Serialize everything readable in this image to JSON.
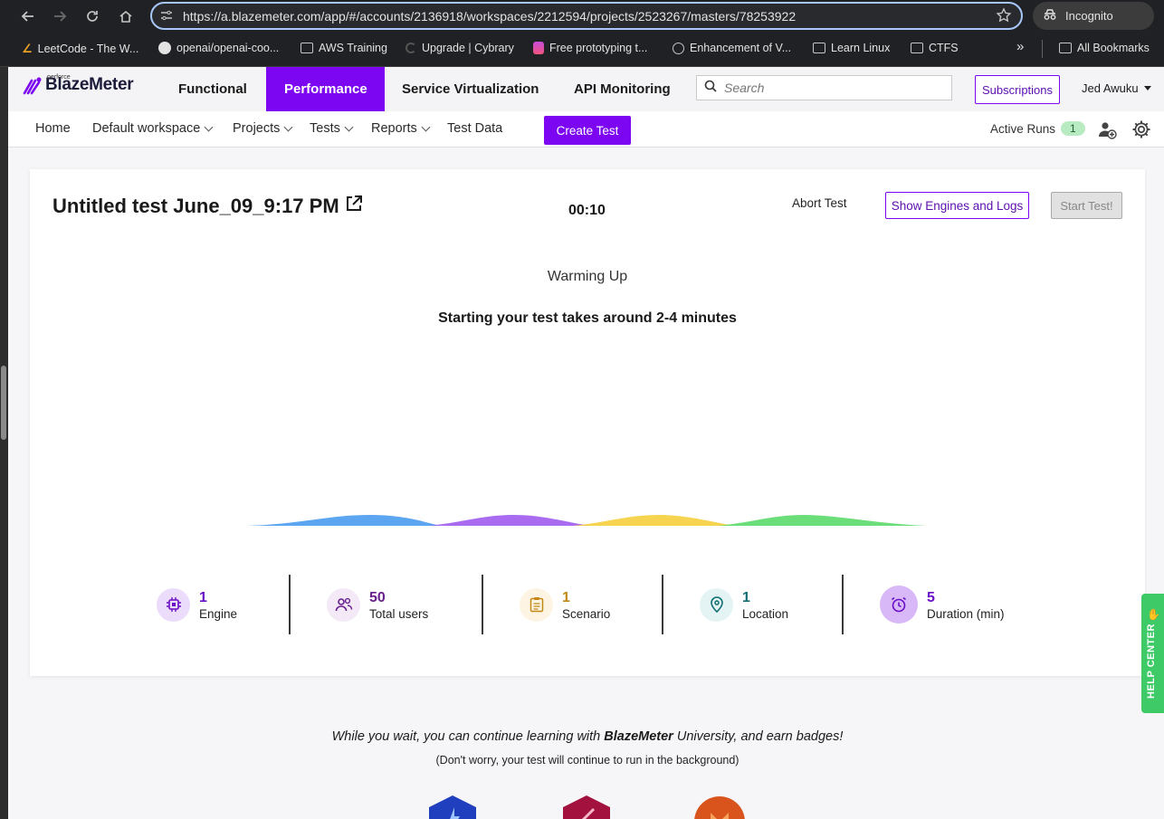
{
  "browser": {
    "url": "https://a.blazemeter.com/app/#/accounts/2136918/workspaces/2212594/projects/2523267/masters/78253922",
    "incognito_label": "Incognito",
    "bookmarks": [
      {
        "label": "LeetCode - The W...",
        "icon": "leetcode-icon"
      },
      {
        "label": "openai/openai-coo...",
        "icon": "github-icon"
      },
      {
        "label": "AWS Training",
        "icon": "folder-icon"
      },
      {
        "label": "Upgrade | Cybrary",
        "icon": "cybrary-icon"
      },
      {
        "label": "Free prototyping t...",
        "icon": "figma-icon"
      },
      {
        "label": "Enhancement of V...",
        "icon": "globe-icon"
      },
      {
        "label": "Learn Linux",
        "icon": "folder-icon"
      },
      {
        "label": "CTFS",
        "icon": "folder-icon"
      }
    ],
    "more_label": "»",
    "all_bookmarks_label": "All Bookmarks"
  },
  "header": {
    "logo_small": "perforce",
    "logo_text": "BlazeMeter",
    "tabs": [
      {
        "label": "Functional",
        "active": false
      },
      {
        "label": "Performance",
        "active": true
      },
      {
        "label": "Service Virtualization",
        "active": false
      },
      {
        "label": "API Monitoring",
        "active": false
      }
    ],
    "search_placeholder": "Search",
    "subscriptions_label": "Subscriptions",
    "user_name": "Jed Awuku"
  },
  "subnav": {
    "home": "Home",
    "workspace": "Default workspace",
    "projects": "Projects",
    "tests": "Tests",
    "reports": "Reports",
    "test_data": "Test Data",
    "create_test": "Create Test",
    "active_runs_label": "Active Runs",
    "active_runs_count": "1"
  },
  "test": {
    "title": "Untitled test June_09_9:17 PM",
    "timer": "00:10",
    "abort_label": "Abort Test",
    "show_engines_label": "Show Engines and Logs",
    "start_label": "Start Test!",
    "status": "Warming Up",
    "status_detail": "Starting your test takes around 2-4 minutes",
    "stats": [
      {
        "value": "1",
        "label": "Engine",
        "icon": "cpu-icon",
        "color": "#6a0dc6",
        "bg": "#ecdcfb"
      },
      {
        "value": "50",
        "label": "Total users",
        "icon": "users-icon",
        "color": "#6a1f8f",
        "bg": "#f3e9f7"
      },
      {
        "value": "1",
        "label": "Scenario",
        "icon": "clipboard-icon",
        "color": "#c28a14",
        "bg": "#fdf4e3"
      },
      {
        "value": "1",
        "label": "Location",
        "icon": "map-pin-icon",
        "color": "#0f6e72",
        "bg": "#e4f4f4"
      },
      {
        "value": "5",
        "label": "Duration (min)",
        "icon": "alarm-icon",
        "color": "#6a0dc6",
        "bg": "#d8b8f7"
      }
    ]
  },
  "learning": {
    "line_prefix": "While you wait, you can continue learning with ",
    "brand": "BlazeMeter",
    "line_suffix": " University, and earn badges!",
    "note": "(Don't worry, your test will continue to run in the background)"
  },
  "help_center_label": "HELP CENTER",
  "colors": {
    "accent": "#7c06f2",
    "wave": [
      "#4a9cf0",
      "#a05cf0",
      "#f5cf3c",
      "#5bd96a"
    ]
  }
}
